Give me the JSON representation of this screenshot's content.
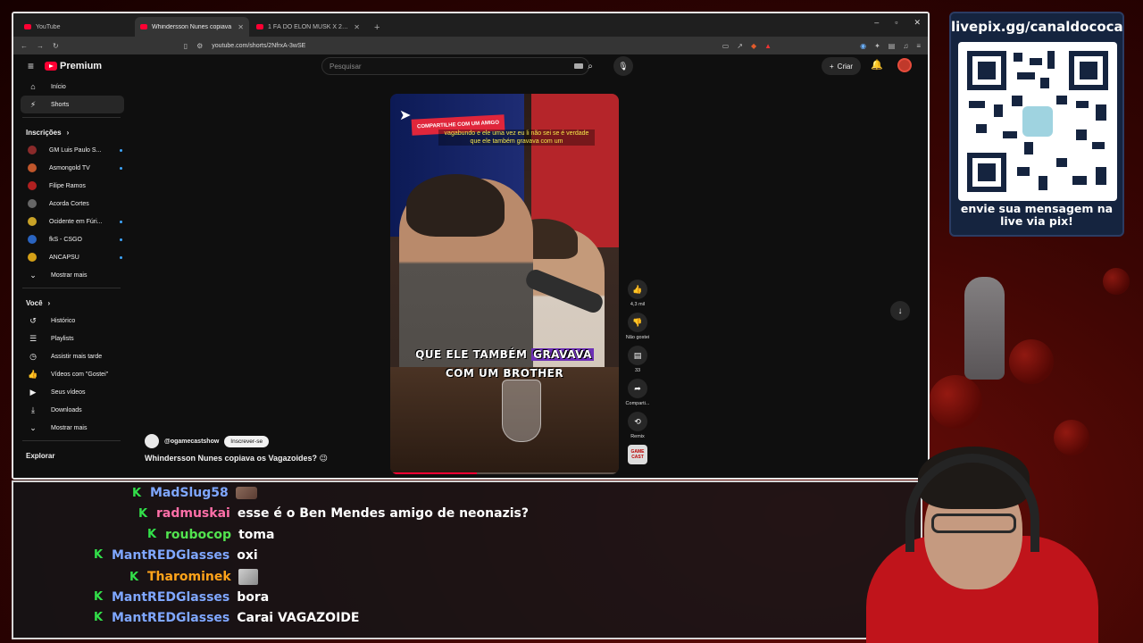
{
  "browser": {
    "tabs": [
      {
        "label": "YouTube",
        "active": false
      },
      {
        "label": "Whindersson Nunes copiava",
        "active": true
      },
      {
        "label": "1 FÃ DO ELON MUSK X 25 HATERS |",
        "active": false
      }
    ],
    "url": "youtube.com/shorts/2NfrxA-3wSE"
  },
  "youtube": {
    "logo_label": "Premium",
    "search_placeholder": "Pesquisar",
    "create_label": "Criar",
    "sidebar": {
      "home": "Início",
      "shorts": "Shorts",
      "subs_header": "Inscrições",
      "subscriptions": [
        {
          "name": "GM Luis Paulo S...",
          "color": "#8a2a2a",
          "new": true
        },
        {
          "name": "Asmongold TV",
          "color": "#c0562b",
          "new": true
        },
        {
          "name": "Filipe Ramos",
          "color": "#b02020",
          "new": false
        },
        {
          "name": "Acorda Cortes",
          "color": "#666666",
          "new": false
        },
        {
          "name": "Ocidente em Fúri...",
          "color": "#c9a227",
          "new": true
        },
        {
          "name": "fkS - CSGO",
          "color": "#2a64c0",
          "new": true
        },
        {
          "name": "ANCAPSU",
          "color": "#d4a017",
          "new": true
        }
      ],
      "show_more": "Mostrar mais",
      "you_header": "Você",
      "you_items": [
        {
          "label": "Histórico",
          "icon": "history-icon"
        },
        {
          "label": "Playlists",
          "icon": "playlist-icon"
        },
        {
          "label": "Assistir mais tarde",
          "icon": "clock-icon"
        },
        {
          "label": "Vídeos com \"Gostei\"",
          "icon": "like-icon"
        },
        {
          "label": "Seus vídeos",
          "icon": "video-icon"
        },
        {
          "label": "Downloads",
          "icon": "download-icon"
        }
      ],
      "show_more_2": "Mostrar mais",
      "explore_header": "Explorar"
    },
    "video": {
      "share_banner": "COMPARTILHE COM UM AMIGO",
      "top_caption": "vagabundo e ele uma vez eu li não sei se é verdade que ele também gravava com um",
      "caption_line1_a": "QUE ELE TAMBÉM ",
      "caption_line1_b": "GRAVAVA",
      "caption_line2": "COM UM BROTHER",
      "progress": 0.38
    },
    "actions": {
      "likes": "4,3 mil",
      "dislike": "Não gostei",
      "comments": "33",
      "share": "Comparti...",
      "remix": "Remix",
      "channel_badge": "GAME CAST"
    },
    "meta": {
      "handle": "@ogamecastshow",
      "subscribe": "Inscrever-se",
      "title": "Whindersson Nunes copiava os Vagazoides? 😉"
    }
  },
  "chat": {
    "messages": [
      {
        "user": "MadSlug58",
        "color": "#7fa7ff",
        "text": "",
        "emote": "emote"
      },
      {
        "user": "radmuskai",
        "color": "#ff6fa8",
        "text": "esse é o Ben Mendes amigo de neonazis?",
        "emote": ""
      },
      {
        "user": "roubocop",
        "color": "#52e34f",
        "text": "toma",
        "emote": ""
      },
      {
        "user": "MantREDGlasses",
        "color": "#7fa7ff",
        "text": "oxi",
        "emote": ""
      },
      {
        "user": "Tharominek",
        "color": "#ffa31a",
        "text": "",
        "emote": "emote2"
      },
      {
        "user": "MantREDGlasses",
        "color": "#7fa7ff",
        "text": "bora",
        "emote": ""
      },
      {
        "user": "MantREDGlasses",
        "color": "#7fa7ff",
        "text": "Carai VAGAZOIDE",
        "emote": ""
      }
    ]
  },
  "qr": {
    "url": "livepix.gg/canaldococa",
    "message": "envie sua mensagem na live via pix!"
  }
}
